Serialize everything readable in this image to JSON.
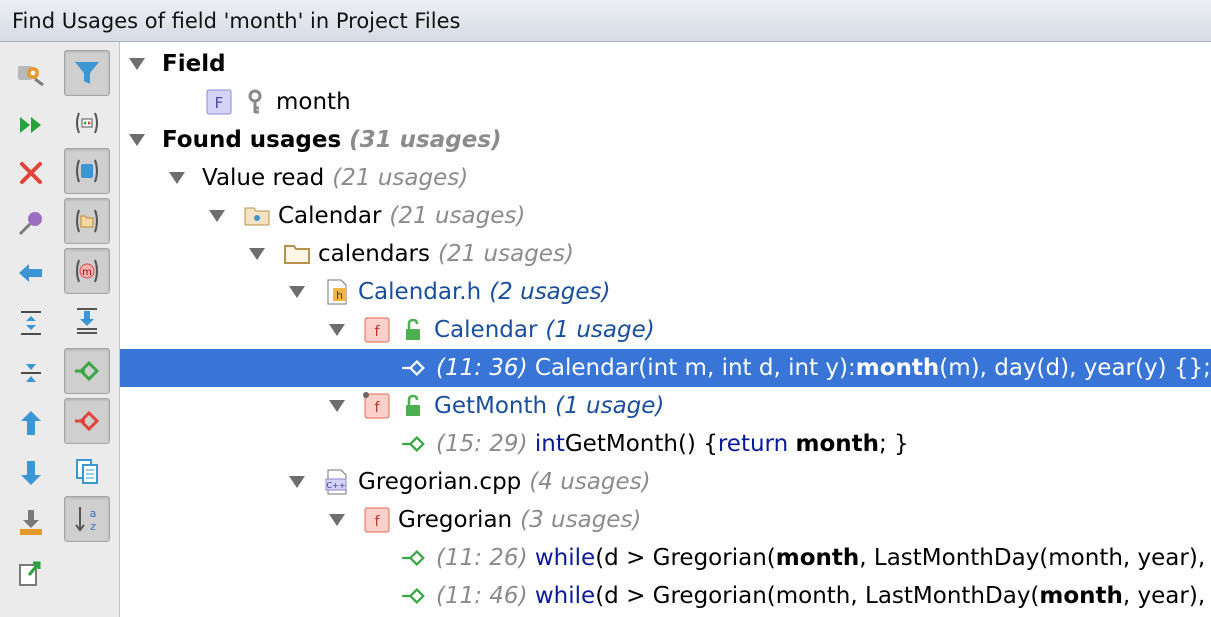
{
  "window": {
    "title": "Find Usages of field 'month' in Project Files"
  },
  "toolbar": {
    "buttons": [
      {
        "name": "settings-button",
        "icon": "gear-wrench-icon"
      },
      {
        "name": "filter-button",
        "icon": "funnel-icon",
        "toggled": true
      },
      {
        "name": "rerun-button",
        "icon": "fast-forward-icon"
      },
      {
        "name": "preview-button",
        "icon": "preview-icon"
      },
      {
        "name": "close-button",
        "icon": "close-icon"
      },
      {
        "name": "group-by-module-button",
        "icon": "module-icon",
        "toggled": true
      },
      {
        "name": "pin-button",
        "icon": "pin-icon"
      },
      {
        "name": "group-by-package-button",
        "icon": "package-icon",
        "toggled": true
      },
      {
        "name": "previous-button",
        "icon": "arrow-left-icon"
      },
      {
        "name": "group-by-method-button",
        "icon": "method-icon",
        "toggled": true
      },
      {
        "name": "expand-all-button",
        "icon": "expand-all-icon"
      },
      {
        "name": "autoscroll-button",
        "icon": "autoscroll-icon"
      },
      {
        "name": "collapse-all-button",
        "icon": "collapse-all-icon"
      },
      {
        "name": "show-read-access-button",
        "icon": "read-access-icon",
        "toggled": true
      },
      {
        "name": "previous-occurrence-button",
        "icon": "arrow-up-icon"
      },
      {
        "name": "show-write-access-button",
        "icon": "write-access-icon",
        "toggled": true
      },
      {
        "name": "next-occurrence-button",
        "icon": "arrow-down-icon"
      },
      {
        "name": "merge-duplicates-button",
        "icon": "merge-icon"
      },
      {
        "name": "import-button",
        "icon": "import-icon"
      },
      {
        "name": "sort-button",
        "icon": "sort-az-icon",
        "toggled": true
      },
      {
        "name": "export-button",
        "icon": "export-icon"
      }
    ]
  },
  "tree": {
    "field_header": "Field",
    "field_name": "month",
    "field_badge": "F",
    "found_header": "Found usages",
    "found_count": "(31 usages)",
    "value_read": "Value read",
    "value_read_count": "(21 usages)",
    "calendar_module": "Calendar",
    "calendar_module_count": "(21 usages)",
    "calendars_dir": "calendars",
    "calendars_dir_count": "(21 usages)",
    "calendar_h": "Calendar.h",
    "calendar_h_count": "(2 usages)",
    "calendar_fn": "Calendar",
    "calendar_fn_count": "(1 usage)",
    "calendar_fn_badge": "f",
    "usage1": {
      "loc": "(11: 36)",
      "pre": "Calendar(int m, int d, int y): ",
      "hit": "month",
      "post": "(m), day(d), year(y) {};"
    },
    "getmonth_fn": "GetMonth",
    "getmonth_fn_count": "(1 usage)",
    "getmonth_fn_badge": "f",
    "usage2": {
      "loc": "(15: 29)",
      "kw1": "int",
      "pre": " GetMonth() { ",
      "kw2": "return",
      "sp": " ",
      "hit": "month",
      "post": "; }"
    },
    "gregorian_cpp": "Gregorian.cpp",
    "gregorian_cpp_count": "(4 usages)",
    "gregorian_cpp_badge": "C++",
    "gregorian_fn": "Gregorian",
    "gregorian_fn_count": "(3 usages)",
    "gregorian_fn_badge": "f",
    "calendar_h_badge": "h",
    "usage3": {
      "loc": "(11: 26)",
      "kw": "while",
      "pre": " (d > Gregorian(",
      "hit": "month",
      "post": ", LastMonthDay(month, year),"
    },
    "usage4": {
      "loc": "(11: 46)",
      "kw": "while",
      "pre": " (d > Gregorian(month, LastMonthDay(",
      "hit": "month",
      "post": ", year),"
    }
  },
  "colors": {
    "selection": "#3875d7",
    "link_blue": "#1a4fa0",
    "usage_count_gray": "#8c8c8c",
    "read_marker_green": "#3aa646"
  }
}
